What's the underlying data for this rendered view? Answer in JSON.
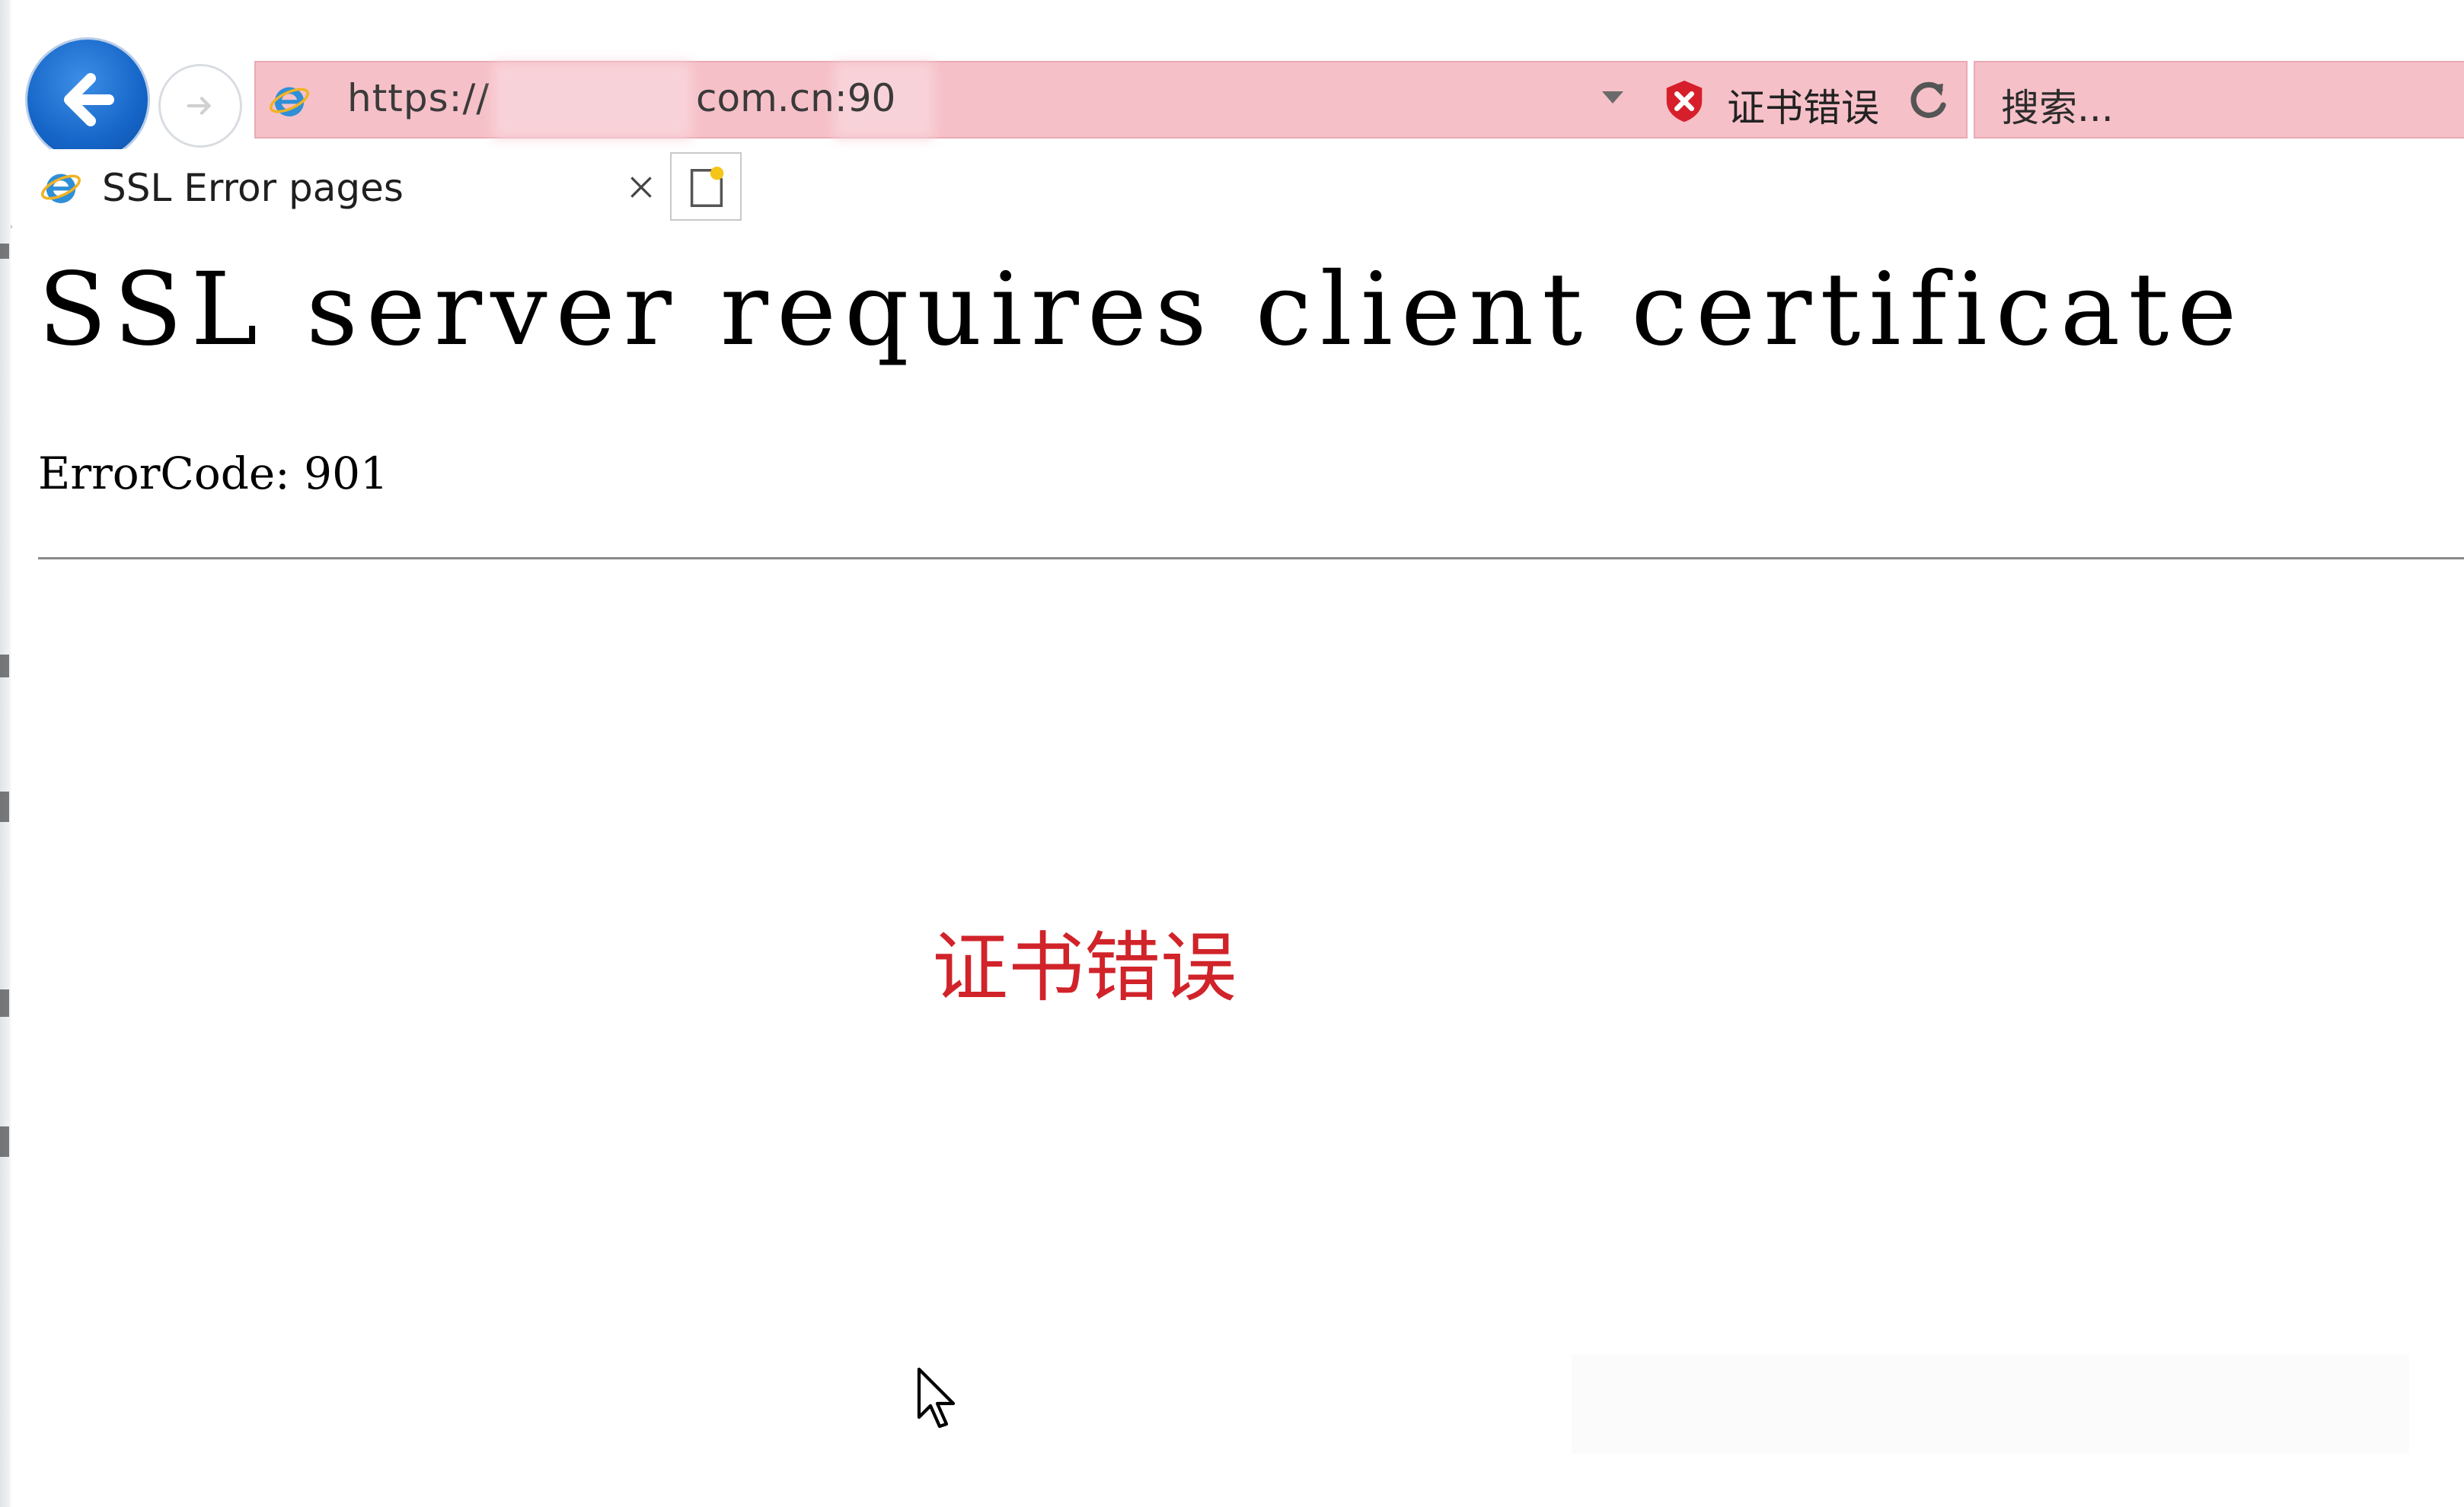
{
  "browser": {
    "address_bar": {
      "url_prefix": "https://",
      "url_suffix": "com.cn:90",
      "certificate_status": "证书错误",
      "colors": {
        "error_bg": "#f6c0c8",
        "error_border": "#e8aab4"
      }
    },
    "search_bar": {
      "placeholder": "搜索..."
    },
    "tabs": [
      {
        "title": "SSL Error pages",
        "active": true
      }
    ],
    "icons": {
      "back": "back-arrow-icon",
      "forward": "forward-arrow-icon",
      "site": "ie-logo-icon",
      "cert": "red-shield-x-icon",
      "refresh": "refresh-icon",
      "dropdown": "chevron-down-icon",
      "close_tab": "close-icon",
      "new_tab": "new-tab-icon"
    }
  },
  "page": {
    "heading": "SSL server requires client certificate",
    "error_code": "ErrorCode: 901",
    "annotation": "证书错误",
    "annotation_color": "#d1232a"
  }
}
